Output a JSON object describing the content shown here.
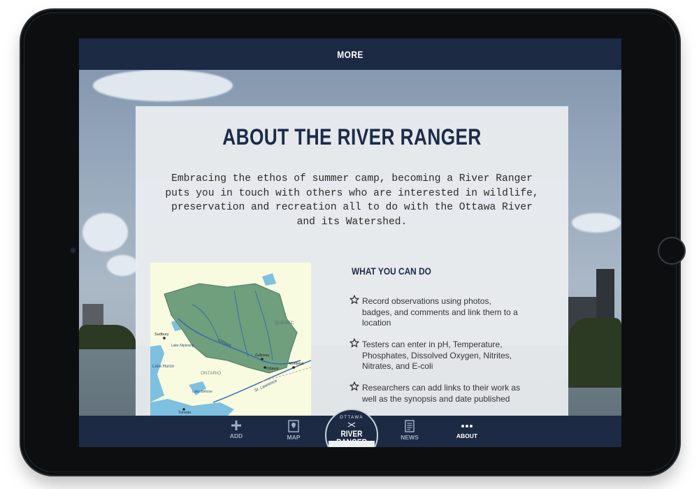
{
  "topbar": {
    "title": "MORE"
  },
  "about": {
    "title": "ABOUT THE RIVER RANGER",
    "intro_lines": [
      "Embracing the ethos of summer camp, becoming a River Ranger",
      "puts you in touch with others who are interested in wildlife,",
      "preservation and recreation all to do with the Ottawa River",
      "and its Watershed."
    ]
  },
  "map": {
    "labels": {
      "quebec": "QUEBEC",
      "ontario": "ONTARIO",
      "ottawa_river": "Ottawa",
      "ottawa_city": "Ottawa",
      "montreal": "Montréal",
      "gatineau": "Gatineau",
      "sudbury": "Sudbury",
      "lake_huron": "Lake Huron",
      "toronto": "Toronto",
      "lake_nipissing": "Lake Nipissing",
      "lake_simcoe": "Lake Simcoe",
      "st_lawrence": "St. Lawrence"
    }
  },
  "features": {
    "heading": "WHAT YOU CAN DO",
    "items": [
      {
        "lines": [
          "Record observations using photos,",
          "badges, and comments and link them to a",
          "location"
        ]
      },
      {
        "lines": [
          "Testers can enter in pH, Temperature,",
          "Phosphates, Dissolved Oxygen, Nitrites,",
          "Nitrates, and E-coli"
        ]
      },
      {
        "lines": [
          "Researchers can add links to their work as",
          "well as the synopsis and date published"
        ]
      }
    ]
  },
  "tabs": [
    {
      "label": "ADD",
      "icon": "plus-icon"
    },
    {
      "label": "MAP",
      "icon": "map-pin-icon"
    },
    {
      "label": "NEWS",
      "icon": "news-icon"
    },
    {
      "label": "ABOUT",
      "icon": "more-dots-icon",
      "active": true
    }
  ],
  "badge": {
    "top": "OTTAWA",
    "name": "RIVER RANGER"
  },
  "colors": {
    "navy": "#1d2a44",
    "title": "#1b2b4a",
    "map_green": "#6f9f7c"
  }
}
